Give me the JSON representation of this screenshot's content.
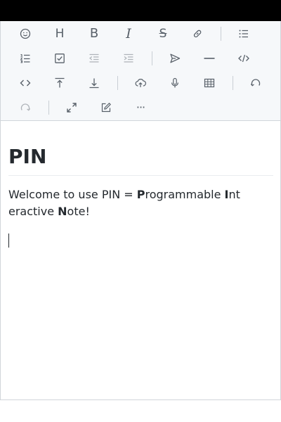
{
  "editor": {
    "heading": "PIN",
    "paragraph": [
      {
        "text": "Welcome to use PIN = ",
        "bold": false
      },
      {
        "text": "P",
        "bold": true
      },
      {
        "text": "rogrammable ",
        "bold": false
      },
      {
        "text": "I",
        "bold": true
      },
      {
        "text": "nteractive ",
        "bold": false
      },
      {
        "text": "N",
        "bold": true
      },
      {
        "text": "ote!",
        "bold": false
      }
    ]
  },
  "toolbar": {
    "heading_glyph": "H",
    "bold_glyph": "B",
    "italic_glyph": "I",
    "strike_glyph": "S",
    "more_glyph": "···"
  },
  "colors": {
    "icon": "#586069",
    "toolbar_bg": "#f6f8fa",
    "border": "#d1d5da",
    "text": "#24292e"
  }
}
